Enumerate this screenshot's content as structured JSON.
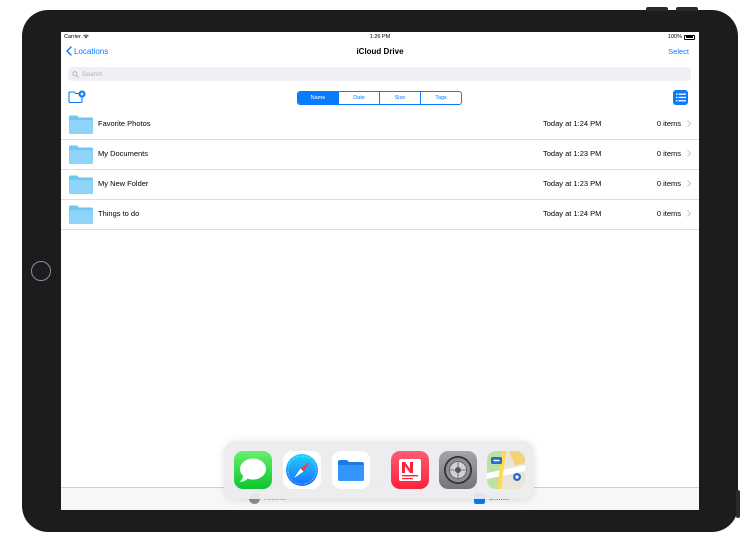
{
  "status": {
    "carrier": "Carrier",
    "time": "1:26 PM",
    "battery": "100%"
  },
  "nav": {
    "back_label": "Locations",
    "title": "iCloud Drive",
    "select_label": "Select"
  },
  "search": {
    "placeholder": "Search"
  },
  "sort": {
    "options": [
      "Name",
      "Date",
      "Size",
      "Tags"
    ],
    "selected": "Name"
  },
  "files": [
    {
      "name": "Favorite Photos",
      "date": "Today at 1:24 PM",
      "count": "0 items"
    },
    {
      "name": "My Documents",
      "date": "Today at 1:23 PM",
      "count": "0 items"
    },
    {
      "name": "My New Folder",
      "date": "Today at 1:23 PM",
      "count": "0 items"
    },
    {
      "name": "Things to do",
      "date": "Today at 1:24 PM",
      "count": "0 items"
    }
  ],
  "tabbar": {
    "recents_label": "Recents",
    "browse_label": "Browse"
  },
  "dock": {
    "apps": [
      "Messages",
      "Safari",
      "Files",
      "News",
      "Settings",
      "Maps"
    ]
  },
  "colors": {
    "accent": "#0a7aff",
    "folder": "#6cc7f5",
    "device": "#1c1c1e"
  },
  "icons": {
    "back": "chevron-left-icon",
    "new_folder": "folder-badge-plus-icon",
    "list_view": "list-icon",
    "row_chevron": "chevron-right-icon"
  }
}
